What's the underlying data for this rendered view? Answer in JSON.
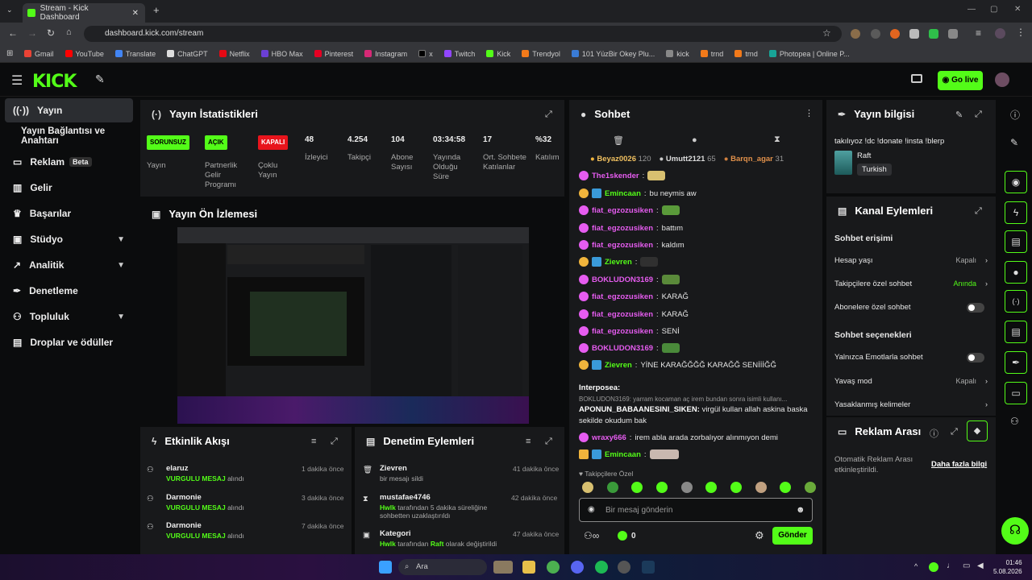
{
  "browser": {
    "tab_title": "Stream - Kick Dashboard",
    "url": "dashboard.kick.com/stream",
    "bookmarks": [
      "Gmail",
      "YouTube",
      "Translate",
      "ChatGPT",
      "Netflix",
      "HBO Max",
      "Pinterest",
      "Instagram",
      "x",
      "Twitch",
      "Kick",
      "Trendyol",
      "101 YüzBir Okey Plu...",
      "kick",
      "trnd",
      "trnd",
      "Photopea | Online P..."
    ]
  },
  "header": {
    "go_live": "Go live",
    "logo": "KICK"
  },
  "sidebar": {
    "items": [
      {
        "label": "Yayın"
      },
      {
        "label": "Yayın Bağlantısı ve Anahtarı"
      },
      {
        "label": "Reklam",
        "badge": "Beta"
      },
      {
        "label": "Gelir"
      },
      {
        "label": "Başarılar"
      },
      {
        "label": "Stüdyo"
      },
      {
        "label": "Analitik"
      },
      {
        "label": "Denetleme"
      },
      {
        "label": "Topluluk"
      },
      {
        "label": "Droplar ve ödüller"
      }
    ]
  },
  "stats": {
    "title": "Yayın İstatistikleri",
    "items": [
      {
        "badge": "SORUNSUZ",
        "label": "Yayın",
        "color": "#53fc18"
      },
      {
        "badge": "AÇIK",
        "label": "Partnerlik Gelir Programı",
        "color": "#53fc18"
      },
      {
        "badge": "KAPALI",
        "label": "Çoklu Yayın",
        "color": "#e8141c"
      },
      {
        "value": "48",
        "label": "İzleyici"
      },
      {
        "value": "4.254",
        "label": "Takipçi"
      },
      {
        "value": "104",
        "label": "Abone Sayısı"
      },
      {
        "value": "03:34:58",
        "label": "Yayında Olduğu Süre"
      },
      {
        "value": "17",
        "label": "Ort. Sohbete Katılanlar"
      },
      {
        "value": "%32",
        "label": "Katılım"
      }
    ]
  },
  "preview": {
    "title": "Yayın Ön İzlemesi"
  },
  "activity": {
    "title": "Etkinlik Akışı",
    "items": [
      {
        "name": "elaruz",
        "tag": "VURGULU MESAJ",
        "suffix": "alındı",
        "time": "1 dakika önce"
      },
      {
        "name": "Darmonie",
        "tag": "VURGULU MESAJ",
        "suffix": "alındı",
        "time": "3 dakika önce"
      },
      {
        "name": "Darmonie",
        "tag": "VURGULU MESAJ",
        "suffix": "alındı",
        "time": "7 dakika önce"
      }
    ]
  },
  "moderation": {
    "title": "Denetim Eylemleri",
    "items": [
      {
        "name": "Zievren",
        "detail": "bir mesajı sildi",
        "time": "41 dakika önce"
      },
      {
        "name": "mustafae4746",
        "actor": "Hwlk",
        "detail": "tarafından 5 dakika süreliğine sohbetten uzaklaştırıldı",
        "time": "42 dakika önce"
      },
      {
        "name": "Kategori",
        "actor": "Hwlk",
        "mid": "tarafından",
        "target": "Raft",
        "detail": "olarak değiştirildi",
        "time": "47 dakika önce"
      }
    ]
  },
  "chat": {
    "title": "Sohbet",
    "top": [
      {
        "name": "Beyaz0026",
        "count": "120"
      },
      {
        "name": "Umutt2121",
        "count": "65"
      },
      {
        "name": "Barqn_agar",
        "count": "31"
      }
    ],
    "messages": [
      {
        "user": "The1skender",
        "text": "",
        "color": "#e65cf0"
      },
      {
        "user": "Emincaan",
        "text": "bu neymis aw",
        "color": "#53fc18"
      },
      {
        "user": "fiat_egzozusiken",
        "text": "",
        "color": "#e65cf0"
      },
      {
        "user": "fiat_egzozusiken",
        "text": "battım",
        "color": "#e65cf0"
      },
      {
        "user": "fiat_egzozusiken",
        "text": "kaldım",
        "color": "#e65cf0"
      },
      {
        "user": "Zievren",
        "text": "",
        "color": "#53fc18"
      },
      {
        "user": "BOKLUDON3169",
        "text": "",
        "color": "#e65cf0"
      },
      {
        "user": "fiat_egzozusiken",
        "text": "KARAĞ",
        "color": "#e65cf0"
      },
      {
        "user": "fiat_egzozusiken",
        "text": "KARAĞ",
        "color": "#e65cf0"
      },
      {
        "user": "fiat_egzozusiken",
        "text": "SENİ",
        "color": "#e65cf0"
      },
      {
        "user": "BOKLUDON3169",
        "text": "",
        "color": "#e65cf0"
      },
      {
        "user": "Zievren",
        "text": "YİNE KARAĞĞĞĞ KARAĞĞ SENİİİĞĞ",
        "color": "#53fc18"
      },
      {
        "user": "Interposea",
        "text": "",
        "color": "#ffffff"
      }
    ],
    "reply_context": "BOKLUDON3169: yarram kocaman aç irem bundan sonra isimli kullanı...",
    "reply_user": "APONUN_BABAANESINI_SIKEN",
    "reply_text": "virgül kullan allah askina baska sekilde okudum bak",
    "tail": [
      {
        "user": "wraxy666",
        "text": "irem abla arada zorbalıyor alınmıyon demi",
        "color": "#e65cf0"
      },
      {
        "user": "Emincaan",
        "text": "",
        "color": "#53fc18"
      }
    ],
    "followers_only": "Takipçilere Özel",
    "input_placeholder": "Bir mesaj gönderin",
    "points": "0",
    "send": "Gönder"
  },
  "stream_info": {
    "title": "Yayın bilgisi",
    "stream_title": "takılıyoz !dc !donate !insta !blerp",
    "category": "Raft",
    "language": "Turkish"
  },
  "channel_actions": {
    "title": "Kanal Eylemleri",
    "access_header": "Sohbet erişimi",
    "rows": [
      {
        "label": "Hesap yaşı",
        "value": "Kapalı"
      },
      {
        "label": "Takipçilere özel sohbet",
        "value": "Anında"
      },
      {
        "label": "Abonelere özel sohbet",
        "value": ""
      }
    ],
    "options_header": "Sohbet seçenekleri",
    "orows": [
      {
        "label": "Yalnızca Emotlarla sohbet",
        "value": ""
      },
      {
        "label": "Yavaş mod",
        "value": "Kapalı"
      },
      {
        "label": "Yasaklanmış kelimeler",
        "value": ""
      }
    ]
  },
  "ad_break": {
    "title": "Reklam Arası",
    "text": "Otomatik Reklam Arası etkinleştirildi.",
    "link": "Daha fazla bilgi"
  },
  "taskbar": {
    "search": "Ara",
    "time": "01:46",
    "date": "5.08.2026"
  }
}
